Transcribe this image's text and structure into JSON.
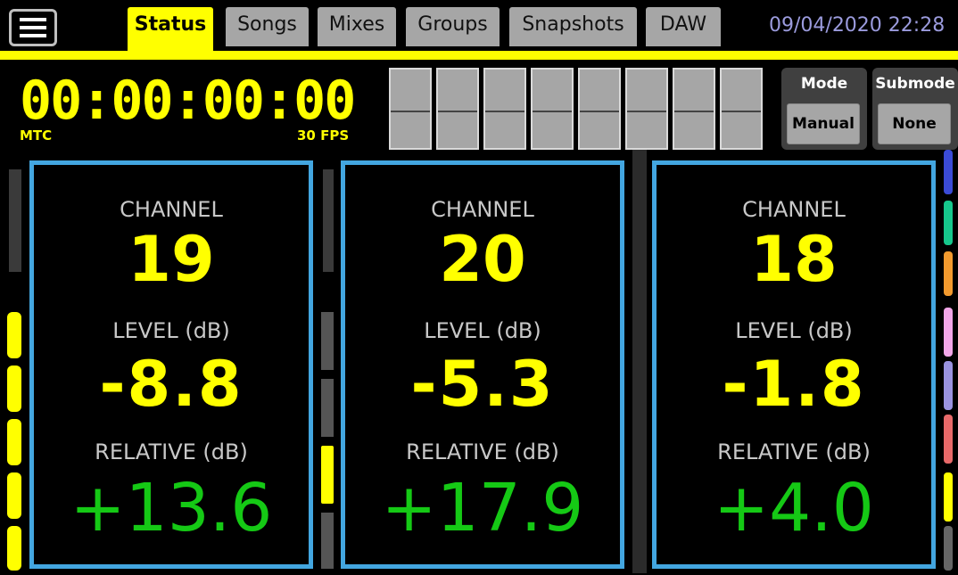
{
  "header": {
    "tabs": [
      {
        "label": "Status",
        "active": true
      },
      {
        "label": "Songs",
        "active": false
      },
      {
        "label": "Mixes",
        "active": false
      },
      {
        "label": "Groups",
        "active": false
      },
      {
        "label": "Snapshots",
        "active": false
      },
      {
        "label": "DAW",
        "active": false
      }
    ],
    "datetime": "09/04/2020 22:28"
  },
  "timecode": {
    "value": "00:00:00:00",
    "source": "MTC",
    "fps": "30 FPS"
  },
  "mode": {
    "title": "Mode",
    "value": "Manual"
  },
  "submode": {
    "title": "Submode",
    "value": "None"
  },
  "channels": [
    {
      "channel_label": "CHANNEL",
      "channel": "19",
      "level_label": "LEVEL (dB)",
      "level": "-8.8",
      "relative_label": "RELATIVE (dB)",
      "relative": "+13.6"
    },
    {
      "channel_label": "CHANNEL",
      "channel": "20",
      "level_label": "LEVEL (dB)",
      "level": "-5.3",
      "relative_label": "RELATIVE (dB)",
      "relative": "+17.9"
    },
    {
      "channel_label": "CHANNEL",
      "channel": "18",
      "level_label": "LEVEL (dB)",
      "level": "-1.8",
      "relative_label": "RELATIVE (dB)",
      "relative": "+4.0"
    }
  ],
  "colors": {
    "accent": "#ffff00",
    "panel_border": "#43a6e0",
    "relative_value": "#15c915",
    "tab_inactive": "#a6a6a6",
    "datetime": "#9b9bdd"
  },
  "icons": {
    "menu": "hamburger-menu-icon"
  }
}
